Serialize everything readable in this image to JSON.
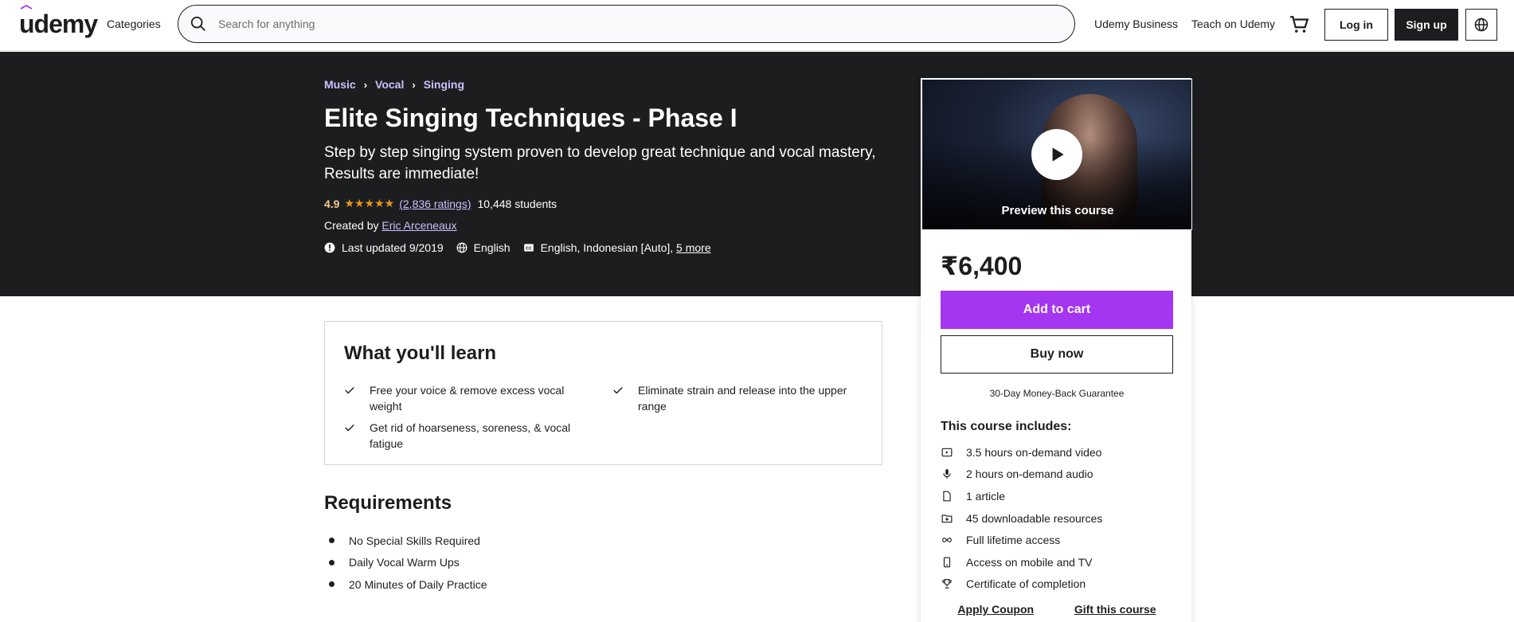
{
  "header": {
    "logo": "udemy",
    "categories": "Categories",
    "search_placeholder": "Search for anything",
    "udemy_business": "Udemy Business",
    "teach": "Teach on Udemy",
    "login": "Log in",
    "signup": "Sign up"
  },
  "breadcrumb": [
    "Music",
    "Vocal",
    "Singing"
  ],
  "course": {
    "title": "Elite Singing Techniques - Phase I",
    "subtitle": "Step by step singing system proven to develop great technique and vocal mastery, Results are immediate!",
    "rating": "4.9",
    "stars": 4.9,
    "ratings_count": "(2,836 ratings)",
    "students": "10,448 students",
    "created_by_label": "Created by",
    "instructor": "Eric Arceneaux",
    "last_updated": "Last updated 9/2019",
    "language": "English",
    "captions": "English, Indonesian [Auto],",
    "captions_more": "5 more"
  },
  "sidebar": {
    "preview_label": "Preview this course",
    "price": "₹6,400",
    "add_to_cart": "Add to cart",
    "buy_now": "Buy now",
    "guarantee": "30-Day Money-Back Guarantee",
    "includes_title": "This course includes:",
    "includes": [
      {
        "icon": "video-icon",
        "label": "3.5 hours on-demand video"
      },
      {
        "icon": "microphone-icon",
        "label": "2 hours on-demand audio"
      },
      {
        "icon": "file-icon",
        "label": "1 article"
      },
      {
        "icon": "folder-download-icon",
        "label": "45 downloadable resources"
      },
      {
        "icon": "infinity-icon",
        "label": "Full lifetime access"
      },
      {
        "icon": "mobile-icon",
        "label": "Access on mobile and TV"
      },
      {
        "icon": "trophy-icon",
        "label": "Certificate of completion"
      }
    ],
    "apply_coupon": "Apply Coupon",
    "gift": "Gift this course"
  },
  "learn": {
    "title": "What you'll learn",
    "items": [
      "Free your voice & remove excess vocal weight",
      "Eliminate strain and release into the upper range",
      "Get rid of hoarseness, soreness, & vocal fatigue"
    ]
  },
  "requirements": {
    "title": "Requirements",
    "items": [
      "No Special Skills Required",
      "Daily Vocal Warm Ups",
      "20 Minutes of Daily Practice"
    ]
  },
  "colors": {
    "accent": "#a435f0",
    "hero_bg": "#1c1d1f",
    "link_purple": "#cec0fc",
    "star": "#e59819"
  }
}
